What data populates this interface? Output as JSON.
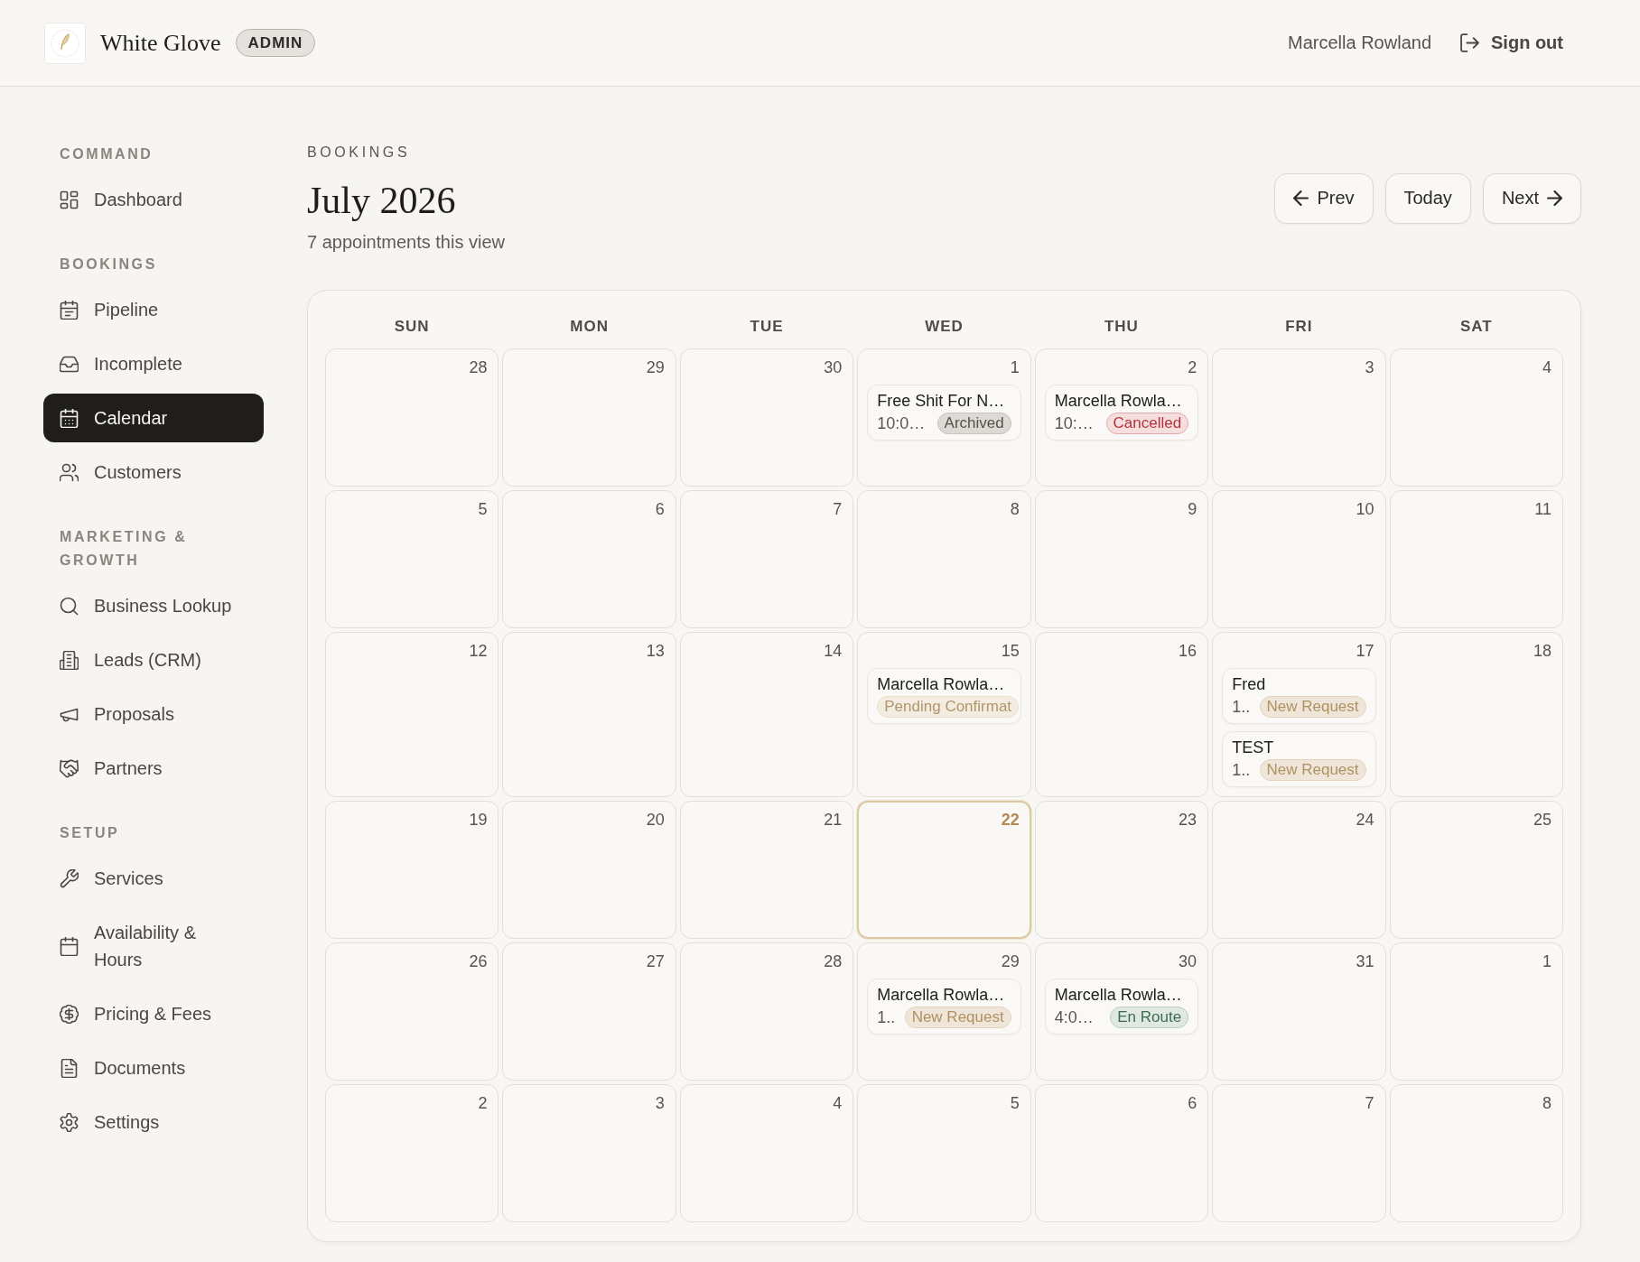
{
  "header": {
    "brand": "White Glove",
    "role_badge": "ADMIN",
    "user_name": "Marcella Rowland",
    "sign_out": "Sign out"
  },
  "sidebar": {
    "sections": [
      {
        "label": "COMMAND",
        "items": [
          {
            "label": "Dashboard",
            "selected": false
          }
        ]
      },
      {
        "label": "BOOKINGS",
        "items": [
          {
            "label": "Pipeline",
            "selected": false
          },
          {
            "label": "Incomplete",
            "selected": false
          },
          {
            "label": "Calendar",
            "selected": true
          },
          {
            "label": "Customers",
            "selected": false
          }
        ]
      },
      {
        "label": "MARKETING & GROWTH",
        "items": [
          {
            "label": "Business Lookup",
            "selected": false
          },
          {
            "label": "Leads (CRM)",
            "selected": false
          },
          {
            "label": "Proposals",
            "selected": false
          },
          {
            "label": "Partners",
            "selected": false
          }
        ]
      },
      {
        "label": "SETUP",
        "items": [
          {
            "label": "Services",
            "selected": false
          },
          {
            "label": "Availability & Hours",
            "selected": false
          },
          {
            "label": "Pricing & Fees",
            "selected": false
          },
          {
            "label": "Documents",
            "selected": false
          },
          {
            "label": "Settings",
            "selected": false
          }
        ]
      }
    ]
  },
  "page": {
    "eyebrow": "BOOKINGS",
    "title": "July 2026",
    "subtitle": "7 appointments this view",
    "nav_buttons": [
      {
        "label": "Prev",
        "kind": "prev"
      },
      {
        "label": "Today",
        "kind": "today"
      },
      {
        "label": "Next",
        "kind": "next"
      }
    ]
  },
  "calendar": {
    "weekdays": [
      "SUN",
      "MON",
      "TUE",
      "WED",
      "THU",
      "FRI",
      "SAT"
    ],
    "weeks": [
      {
        "days": [
          {
            "date": "28",
            "today": false
          },
          {
            "date": "29",
            "today": false
          },
          {
            "date": "30",
            "today": false
          },
          {
            "date": "1",
            "today": false,
            "events": [
              {
                "title": "Free Shit For N…",
                "time": "10:0…",
                "status": "Archived",
                "kind": "archived"
              }
            ]
          },
          {
            "date": "2",
            "today": false,
            "events": [
              {
                "title": "Marcella Rowla…",
                "time": "10:…",
                "status": "Cancelled",
                "kind": "cancelled"
              }
            ]
          },
          {
            "date": "3",
            "today": false
          },
          {
            "date": "4",
            "today": false
          }
        ]
      },
      {
        "days": [
          {
            "date": "5",
            "today": false
          },
          {
            "date": "6",
            "today": false
          },
          {
            "date": "7",
            "today": false
          },
          {
            "date": "8",
            "today": false
          },
          {
            "date": "9",
            "today": false
          },
          {
            "date": "10",
            "today": false
          },
          {
            "date": "11",
            "today": false
          }
        ]
      },
      {
        "days": [
          {
            "date": "12",
            "today": false
          },
          {
            "date": "13",
            "today": false
          },
          {
            "date": "14",
            "today": false
          },
          {
            "date": "15",
            "today": false,
            "events": [
              {
                "title": "Marcella Rowla…",
                "status": "Pending Confirmat",
                "kind": "pending"
              }
            ]
          },
          {
            "date": "16",
            "today": false
          },
          {
            "date": "17",
            "today": false,
            "events": [
              {
                "title": "Fred",
                "time": "1..",
                "status": "New Request",
                "kind": "new"
              },
              {
                "title": "TEST",
                "time": "1..",
                "status": "New Request",
                "kind": "new"
              }
            ]
          },
          {
            "date": "18",
            "today": false
          }
        ]
      },
      {
        "days": [
          {
            "date": "19",
            "today": false
          },
          {
            "date": "20",
            "today": false
          },
          {
            "date": "21",
            "today": false
          },
          {
            "date": "22",
            "today": true
          },
          {
            "date": "23",
            "today": false
          },
          {
            "date": "24",
            "today": false
          },
          {
            "date": "25",
            "today": false
          }
        ]
      },
      {
        "days": [
          {
            "date": "26",
            "today": false
          },
          {
            "date": "27",
            "today": false
          },
          {
            "date": "28",
            "today": false
          },
          {
            "date": "29",
            "today": false,
            "events": [
              {
                "title": "Marcella Rowla…",
                "time": "1..",
                "status": "New Request",
                "kind": "new"
              }
            ]
          },
          {
            "date": "30",
            "today": false,
            "events": [
              {
                "title": "Marcella Rowla…",
                "time": "4:0…",
                "status": "En Route",
                "kind": "en_route"
              }
            ]
          },
          {
            "date": "31",
            "today": false
          },
          {
            "date": "1",
            "today": false
          }
        ]
      },
      {
        "days": [
          {
            "date": "2",
            "today": false
          },
          {
            "date": "3",
            "today": false
          },
          {
            "date": "4",
            "today": false
          },
          {
            "date": "5",
            "today": false
          },
          {
            "date": "6",
            "today": false
          },
          {
            "date": "7",
            "today": false
          },
          {
            "date": "8",
            "today": false
          }
        ]
      }
    ]
  }
}
